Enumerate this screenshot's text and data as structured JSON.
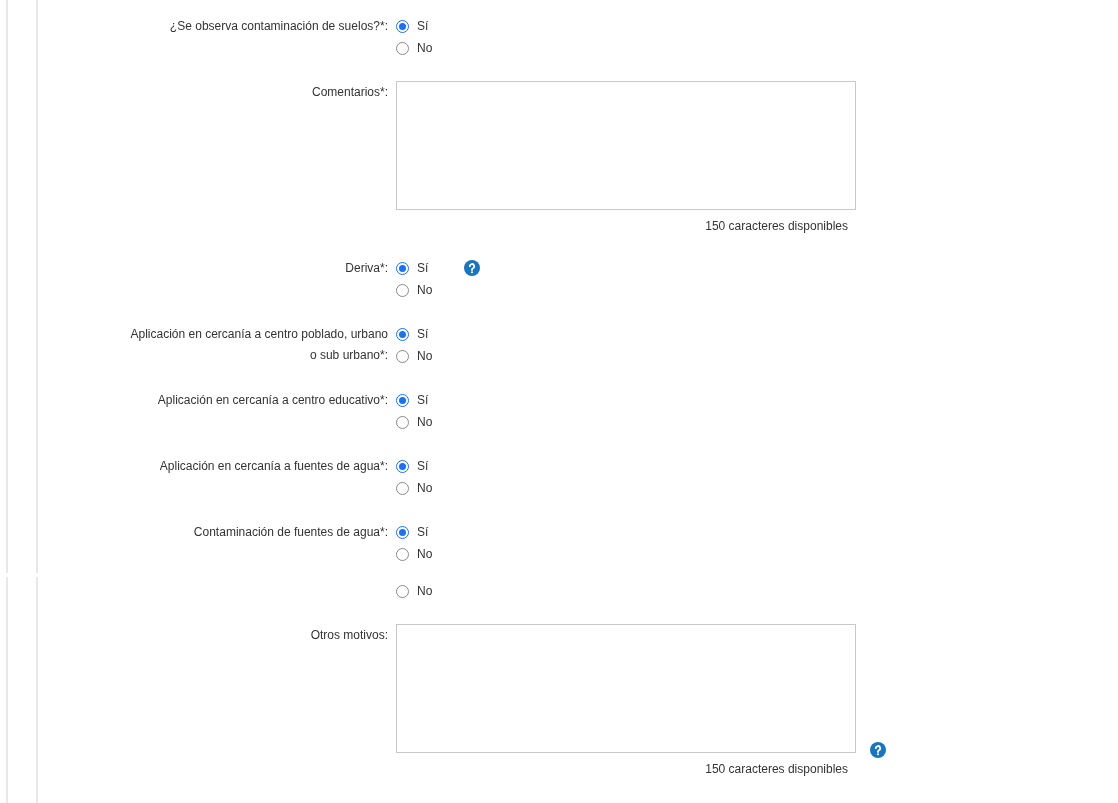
{
  "panels": [
    {
      "fields": [
        {
          "kind": "radio",
          "label": "¿Se observa contaminación de suelos?*:",
          "help": false,
          "options": [
            {
              "label": "Sí",
              "selected": true
            },
            {
              "label": "No",
              "selected": false
            }
          ]
        },
        {
          "kind": "textarea",
          "label": "Comentarios*:",
          "help": false,
          "counter": "150 caracteres disponibles"
        },
        {
          "kind": "radio",
          "label": "Deriva*:",
          "help": true,
          "options": [
            {
              "label": "Sí",
              "selected": true
            },
            {
              "label": "No",
              "selected": false
            }
          ]
        },
        {
          "kind": "radio",
          "label": "Aplicación en cercanía a centro poblado, urbano o sub urbano*:",
          "help": false,
          "options": [
            {
              "label": "Sí",
              "selected": true
            },
            {
              "label": "No",
              "selected": false
            }
          ]
        },
        {
          "kind": "radio",
          "label": "Aplicación en cercanía a centro educativo*:",
          "help": false,
          "options": [
            {
              "label": "Sí",
              "selected": true
            },
            {
              "label": "No",
              "selected": false
            }
          ]
        },
        {
          "kind": "radio",
          "label": "Aplicación en cercanía a fuentes de agua*:",
          "help": false,
          "options": [
            {
              "label": "Sí",
              "selected": true
            },
            {
              "label": "No",
              "selected": false
            }
          ]
        },
        {
          "kind": "radio",
          "label": "Contaminación de fuentes de agua*:",
          "help": false,
          "options": [
            {
              "label": "Sí",
              "selected": true
            },
            {
              "label": "No",
              "selected": false
            }
          ]
        }
      ]
    },
    {
      "fields": [
        {
          "kind": "radio",
          "help": false,
          "options": [
            {
              "label": "No",
              "selected": false
            }
          ]
        },
        {
          "kind": "textarea",
          "label": "Otros motivos:",
          "help": true,
          "counter": "150 caracteres disponibles"
        }
      ]
    }
  ]
}
